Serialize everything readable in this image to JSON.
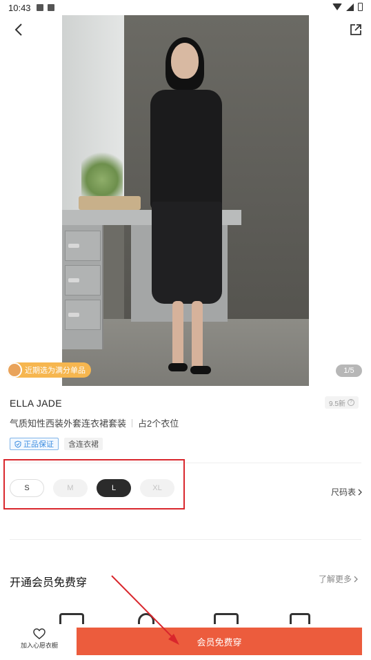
{
  "status_bar": {
    "time": "10:43"
  },
  "gallery": {
    "counter": "1/5",
    "promo_tag": "近期选为满分单品"
  },
  "product": {
    "brand": "ELLA JADE",
    "condition": "9.5新",
    "title": "气质知性西装外套连衣裙套装",
    "slots": "占2个衣位",
    "tags": {
      "authentic": "正品保证",
      "includes": "含连衣裙"
    }
  },
  "sizes": {
    "options": [
      "S",
      "M",
      "L",
      "XL"
    ],
    "selected": "L",
    "size_chart_label": "尺码表"
  },
  "membership": {
    "title": "开通会员免费穿",
    "learn_more": "了解更多"
  },
  "bottom_bar": {
    "wishlist_label": "加入心愿衣橱",
    "cta_label": "会员免费穿"
  },
  "colors": {
    "accent": "#ec5c3d",
    "highlight_box": "#d9262c",
    "promo": "#f6b64f",
    "authentic_blue": "#3d8ee0"
  }
}
